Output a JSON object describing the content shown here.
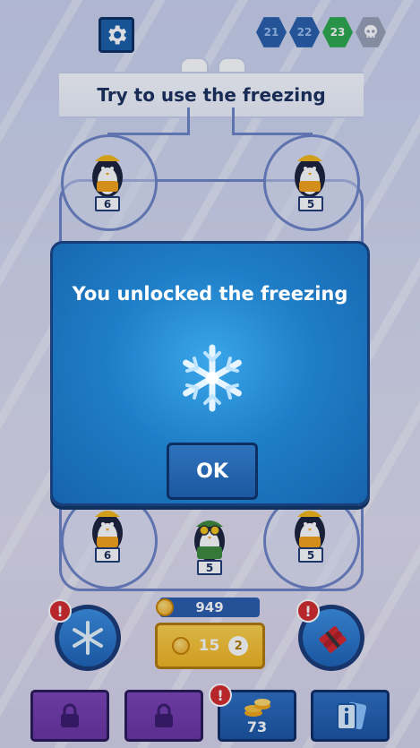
{
  "header": {
    "levels": [
      "21",
      "22",
      "23"
    ],
    "current_level": "23",
    "boss_icon": "skull-icon",
    "settings_icon": "gear-icon"
  },
  "banner": {
    "text": "Try to use the freezing"
  },
  "board": {
    "penguins": [
      {
        "position": "top-left",
        "value": "6"
      },
      {
        "position": "top-right",
        "value": "5"
      },
      {
        "position": "bottom-left",
        "value": "6"
      },
      {
        "position": "bottom-center",
        "value": "5"
      },
      {
        "position": "bottom-right",
        "value": "5"
      }
    ]
  },
  "modal": {
    "title": "You unlocked the freezing",
    "icon": "snowflake-icon",
    "ok_label": "OK"
  },
  "controls": {
    "coins": "949",
    "buy_price": "15",
    "buy_count": "2",
    "freeze_alert": "!",
    "dynamite_alert": "!",
    "shop_alert": "!",
    "shop_value": "73"
  },
  "colors": {
    "primary_blue": "#1f7ec7",
    "current_level_green": "#2ea84a",
    "alert_red": "#d52a2a",
    "gold": "#f3b51d",
    "locked_purple": "#7d43b5"
  }
}
